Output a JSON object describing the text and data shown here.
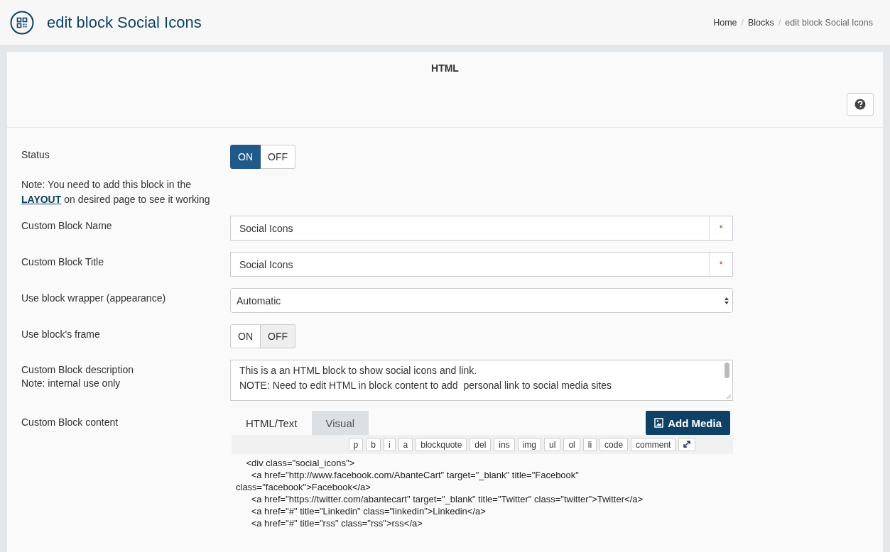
{
  "page": {
    "title": "edit block Social Icons"
  },
  "breadcrumb": {
    "separator": "/",
    "items": [
      {
        "label": "Home"
      },
      {
        "label": "Blocks"
      },
      {
        "label": "edit block Social Icons"
      }
    ]
  },
  "panel": {
    "title": "HTML"
  },
  "fields": [
    {
      "kind": "toggle",
      "label": "Status",
      "options": [
        {
          "label": "ON",
          "selected": true
        },
        {
          "label": "OFF",
          "selected": false
        }
      ]
    },
    {
      "kind": "note",
      "text_before": "Note: You need to add this block in the",
      "link": "LAYOUT",
      "text_after": "on desired page to see it working"
    },
    {
      "kind": "text",
      "label": "Custom Block Name",
      "value": "Social Icons",
      "required_mark": "*"
    },
    {
      "kind": "text",
      "label": "Custom Block Title",
      "value": "Social Icons",
      "required_mark": "*"
    },
    {
      "kind": "select",
      "label": "Use block wrapper (appearance)",
      "value": "Automatic"
    },
    {
      "kind": "toggle",
      "label": "Use block's frame",
      "options": [
        {
          "label": "ON",
          "selected": false
        },
        {
          "label": "OFF",
          "selected": true
        }
      ]
    },
    {
      "kind": "textarea",
      "label": "Custom Block description",
      "sublabel": "Note: internal use only",
      "lines": [
        "This is a an HTML block to show social icons and link.",
        "NOTE: Need to edit HTML in block content to add  personal link to social media sites"
      ]
    },
    {
      "kind": "editor",
      "label": "Custom Block content",
      "tabs": [
        {
          "label": "HTML/Text",
          "selected": true
        },
        {
          "label": "Visual",
          "selected": false
        }
      ],
      "action": "Add Media",
      "toolbar": [
        "p",
        "b",
        "i",
        "a",
        "blockquote",
        "del",
        "ins",
        "img",
        "ul",
        "ol",
        "li",
        "code",
        "comment"
      ],
      "code": [
        "    <div class=\"social_icons\">",
        "      <a href=\"http://www.facebook.com/AbanteCart\" target=\"_blank\" title=\"Facebook\"",
        "class=\"facebook\">Facebook</a>",
        "      <a href=\"https://twitter.com/abantecart\" target=\"_blank\" title=\"Twitter\" class=\"twitter\">Twitter</a>",
        "      <a href=\"#\" title=\"Linkedin\" class=\"linkedin\">Linkedin</a>",
        "      <a href=\"#\" title=\"rss\" class=\"rss\">rss</a>"
      ]
    }
  ]
}
